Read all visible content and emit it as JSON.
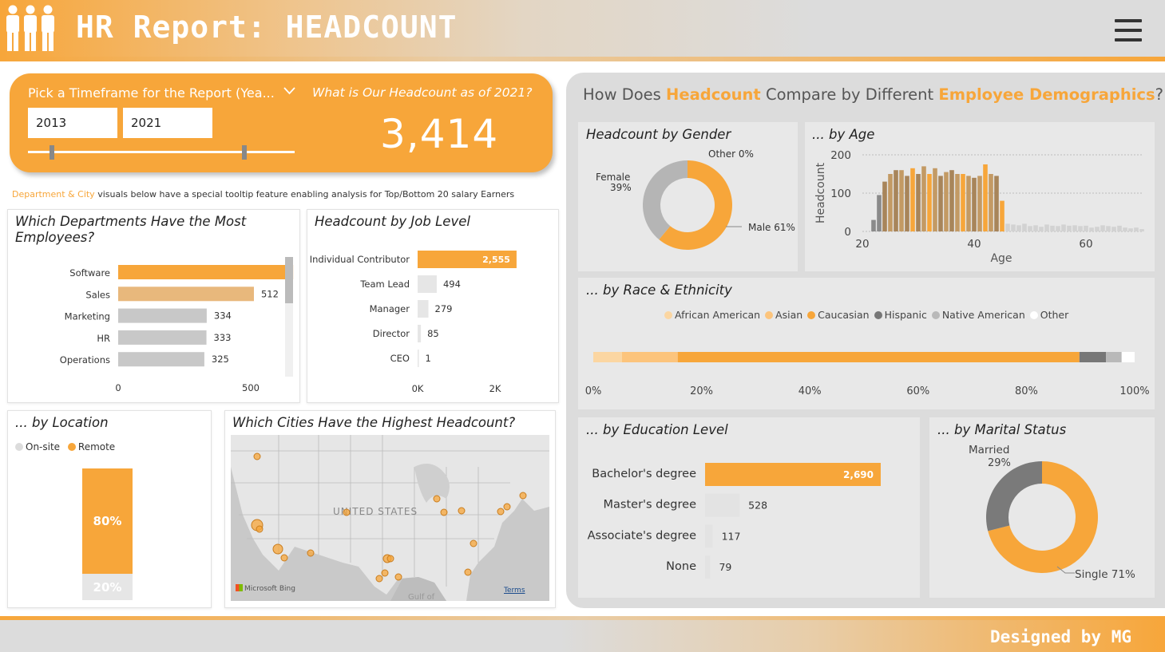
{
  "header": {
    "title": "HR Report: HEADCOUNT",
    "logo_icon": "people-icon",
    "menu_icon": "hamburger-menu-icon"
  },
  "filter": {
    "label": "Pick a Timeframe for the Report (Yea...",
    "start_year": "2013",
    "end_year": "2021",
    "headcount_question": "What is Our Headcount as of 2021?",
    "headcount_value": "3,414"
  },
  "tooltip_note": {
    "highlight": "Department & City",
    "text": " visuals below have a special tooltip feature enabling analysis for Top/Bottom 20 salary Earners"
  },
  "departments": {
    "title": "Which Departments Have the Most Employees?",
    "categories": [
      "Software",
      "Sales",
      "Marketing",
      "HR",
      "Operations"
    ],
    "values": [
      660,
      512,
      334,
      333,
      325
    ],
    "x_ticks": [
      "0",
      "500"
    ]
  },
  "job_level": {
    "title": "Headcount by Job Level",
    "categories": [
      "Individual Contributor",
      "Team Lead",
      "Manager",
      "Director",
      "CEO"
    ],
    "values": [
      2555,
      494,
      279,
      85,
      1
    ],
    "labels": [
      "2,555",
      "494",
      "279",
      "85",
      "1"
    ],
    "x_ticks": [
      "0K",
      "2K"
    ]
  },
  "location": {
    "title": "... by Location",
    "legend": [
      "On-site",
      "Remote"
    ],
    "remote_pct": "80%",
    "onsite_pct": "20%"
  },
  "cities": {
    "title": "Which Cities Have the Highest Headcount?",
    "map_label": "UNITED STATES",
    "gulf_label": "Gulf of",
    "attribution": "Microsoft Bing",
    "terms": "Terms"
  },
  "demographics": {
    "title_parts": [
      "How Does ",
      "Headcount",
      " Compare by Different ",
      "Employee Demographics",
      "?"
    ]
  },
  "gender": {
    "title": "Headcount by Gender",
    "labels": [
      "Other 0%",
      "Female",
      "39%",
      "Male 61%"
    ],
    "chart_data": {
      "type": "pie",
      "categories": [
        "Male",
        "Female",
        "Other"
      ],
      "values": [
        61,
        39,
        0
      ]
    }
  },
  "age": {
    "title": "... by Age",
    "ylabel": "Headcount",
    "xlabel": "Age",
    "y_ticks": [
      "200",
      "100",
      "0"
    ],
    "x_ticks": [
      "20",
      "40",
      "60"
    ],
    "chart_data": {
      "type": "bar",
      "x": [
        22,
        23,
        24,
        25,
        26,
        27,
        28,
        29,
        30,
        31,
        32,
        33,
        34,
        35,
        36,
        37,
        38,
        39,
        40,
        41,
        42,
        43,
        44,
        45,
        46,
        47,
        48,
        49,
        50,
        51,
        52,
        53,
        54,
        55,
        56,
        57,
        58,
        59,
        60,
        61,
        62,
        63,
        64,
        65,
        66,
        67,
        68,
        69,
        70
      ],
      "values": [
        30,
        95,
        130,
        150,
        160,
        160,
        145,
        165,
        150,
        170,
        150,
        165,
        145,
        155,
        160,
        150,
        150,
        145,
        140,
        145,
        175,
        150,
        145,
        80,
        20,
        18,
        16,
        20,
        14,
        16,
        12,
        18,
        15,
        14,
        18,
        15,
        16,
        14,
        15,
        10,
        12,
        16,
        14,
        12,
        15,
        10,
        8,
        10,
        6
      ],
      "ylim": [
        0,
        200
      ]
    }
  },
  "race": {
    "title": "... by Race & Ethnicity",
    "legend": [
      "African American",
      "Asian",
      "Caucasian",
      "Hispanic",
      "Native American",
      "Other"
    ],
    "x_ticks": [
      "0%",
      "20%",
      "40%",
      "60%",
      "80%",
      "100%"
    ],
    "chart_data": {
      "type": "bar",
      "categories": [
        "African American",
        "Asian",
        "Caucasian",
        "Hispanic",
        "Native American",
        "Other"
      ],
      "values": [
        5.3,
        10.3,
        74.2,
        4.9,
        2.9,
        2.4
      ]
    }
  },
  "education": {
    "title": "... by Education Level",
    "categories": [
      "Bachelor's degree",
      "Master's degree",
      "Associate's degree",
      "None"
    ],
    "values": [
      2690,
      528,
      117,
      79
    ],
    "labels": [
      "2,690",
      "528",
      "117",
      "79"
    ]
  },
  "marital": {
    "title": "... by Marital Status",
    "labels": [
      "Married",
      "29%",
      "Single 71%"
    ],
    "chart_data": {
      "type": "pie",
      "categories": [
        "Single",
        "Married"
      ],
      "values": [
        71,
        29
      ]
    }
  },
  "footer": {
    "text": "Designed by MG"
  },
  "colors": {
    "orange": "#f7a63a",
    "light_orange": "#e8b87c",
    "pale_orange": "#fbd6a2",
    "gray": "#c8c8c8",
    "dark_gray": "#777777"
  }
}
